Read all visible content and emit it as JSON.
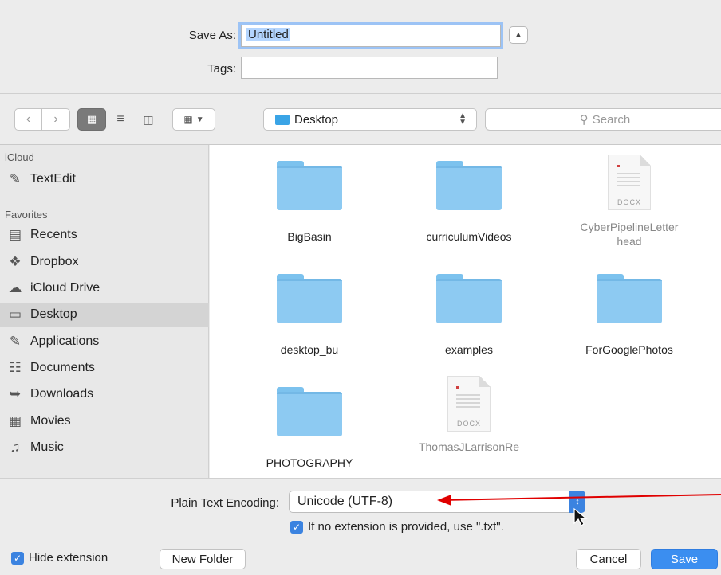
{
  "save_as": {
    "label": "Save As:",
    "value": "Untitled"
  },
  "tags": {
    "label": "Tags:",
    "value": ""
  },
  "toolbar": {
    "location": "Desktop",
    "search_placeholder": "Search"
  },
  "sidebar": {
    "sections": [
      {
        "title": "iCloud",
        "items": [
          {
            "label": "TextEdit",
            "icon": "textedit-icon"
          }
        ]
      },
      {
        "title": "Favorites",
        "items": [
          {
            "label": "Recents",
            "icon": "recents-icon"
          },
          {
            "label": "Dropbox",
            "icon": "dropbox-icon"
          },
          {
            "label": "iCloud Drive",
            "icon": "cloud-icon"
          },
          {
            "label": "Desktop",
            "icon": "desktop-icon",
            "active": true
          },
          {
            "label": "Applications",
            "icon": "applications-icon"
          },
          {
            "label": "Documents",
            "icon": "documents-icon"
          },
          {
            "label": "Downloads",
            "icon": "downloads-icon"
          },
          {
            "label": "Movies",
            "icon": "movies-icon"
          },
          {
            "label": "Music",
            "icon": "music-icon"
          }
        ]
      }
    ]
  },
  "files": [
    {
      "name": "BigBasin",
      "kind": "folder"
    },
    {
      "name": "curriculumVideos",
      "kind": "folder"
    },
    {
      "name": "CyberPipelineLetter head",
      "kind": "docx",
      "badge": "DOCX"
    },
    {
      "name": "desktop_bu",
      "kind": "folder"
    },
    {
      "name": "examples",
      "kind": "folder"
    },
    {
      "name": "ForGooglePhotos",
      "kind": "folder"
    },
    {
      "name": "PHOTOGRAPHY",
      "kind": "folder"
    },
    {
      "name": "ThomasJLarrisonRe",
      "kind": "docx",
      "badge": "DOCX"
    }
  ],
  "encoding": {
    "label": "Plain Text Encoding:",
    "value": "Unicode (UTF-8)",
    "checkbox_label": "If no extension is provided, use \".txt\".",
    "checkbox_checked": true
  },
  "bottom": {
    "hide_extension_label": "Hide extension",
    "hide_extension_checked": true,
    "new_folder": "New Folder",
    "cancel": "Cancel",
    "save": "Save"
  },
  "colors": {
    "accent": "#3b8ef0",
    "annotation_arrow": "#e00000",
    "folder": "#8dcaf2"
  }
}
